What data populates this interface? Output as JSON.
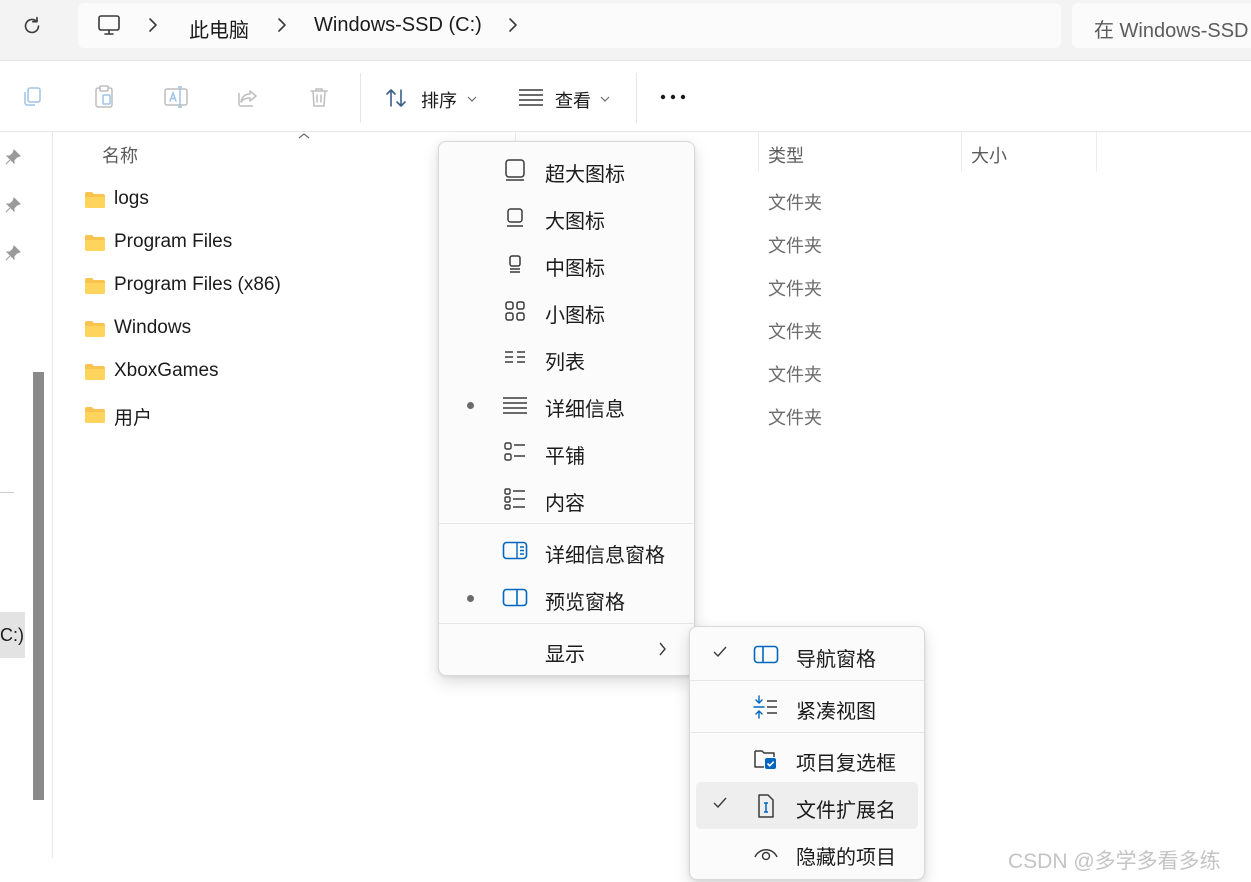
{
  "breadcrumb": {
    "items": [
      "此电脑",
      "Windows-SSD (C:)"
    ]
  },
  "search": {
    "placeholder": "在 Windows-SSD"
  },
  "toolbar": {
    "sort_label": "排序",
    "view_label": "查看"
  },
  "nav": {
    "drive_label": "C:)"
  },
  "columns": {
    "name": "名称",
    "type": "类型",
    "size": "大小"
  },
  "files": [
    {
      "name": "logs",
      "type": "文件夹"
    },
    {
      "name": "Program Files",
      "type": "文件夹"
    },
    {
      "name": "Program Files (x86)",
      "type": "文件夹"
    },
    {
      "name": "Windows",
      "type": "文件夹"
    },
    {
      "name": "XboxGames",
      "type": "文件夹"
    },
    {
      "name": "用户",
      "type": "文件夹"
    }
  ],
  "view_menu": {
    "items": [
      {
        "label": "超大图标",
        "selected": false,
        "icon": "extra-large-icons-icon"
      },
      {
        "label": "大图标",
        "selected": false,
        "icon": "large-icons-icon"
      },
      {
        "label": "中图标",
        "selected": false,
        "icon": "medium-icons-icon"
      },
      {
        "label": "小图标",
        "selected": false,
        "icon": "small-icons-icon"
      },
      {
        "label": "列表",
        "selected": false,
        "icon": "list-icon"
      },
      {
        "label": "详细信息",
        "selected": true,
        "icon": "details-icon"
      },
      {
        "label": "平铺",
        "selected": false,
        "icon": "tiles-icon"
      },
      {
        "label": "内容",
        "selected": false,
        "icon": "content-icon"
      }
    ],
    "pane_items": [
      {
        "label": "详细信息窗格",
        "selected": false,
        "icon": "details-pane-icon"
      },
      {
        "label": "预览窗格",
        "selected": true,
        "icon": "preview-pane-icon"
      }
    ],
    "show_label": "显示"
  },
  "show_menu": {
    "items": [
      {
        "label": "导航窗格",
        "checked": true,
        "icon": "navigation-pane-icon"
      },
      {
        "label": "紧凑视图",
        "checked": false,
        "icon": "compact-view-icon"
      },
      {
        "label": "项目复选框",
        "checked": false,
        "icon": "item-checkbox-icon"
      },
      {
        "label": "文件扩展名",
        "checked": true,
        "icon": "file-extension-icon"
      },
      {
        "label": "隐藏的项目",
        "checked": false,
        "icon": "hidden-items-icon"
      }
    ]
  },
  "watermark": "CSDN @多学多看多练",
  "colors": {
    "accent": "#0067c0",
    "folder": "#f8c44f",
    "hover": "#eeeeee"
  }
}
